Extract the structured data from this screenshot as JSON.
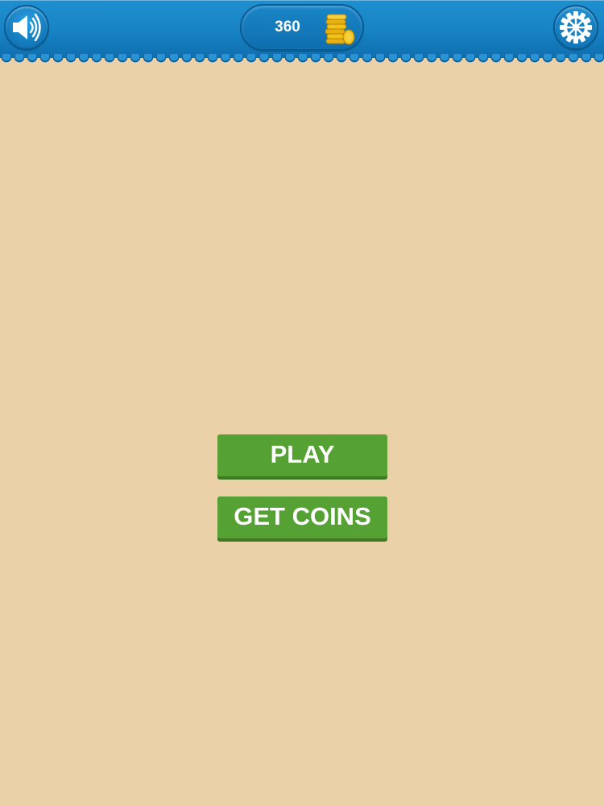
{
  "header": {
    "coin_count": "360",
    "sound_icon": "speaker-icon",
    "settings_icon": "gear-icon",
    "coin_icon": "coin-stack-icon"
  },
  "menu": {
    "play_label": "PLAY",
    "get_coins_label": "GET COINS"
  },
  "colors": {
    "background": "#ebd1a8",
    "header_blue": "#1783c4",
    "button_green": "#55a133",
    "coin_gold": "#f2c21b"
  }
}
